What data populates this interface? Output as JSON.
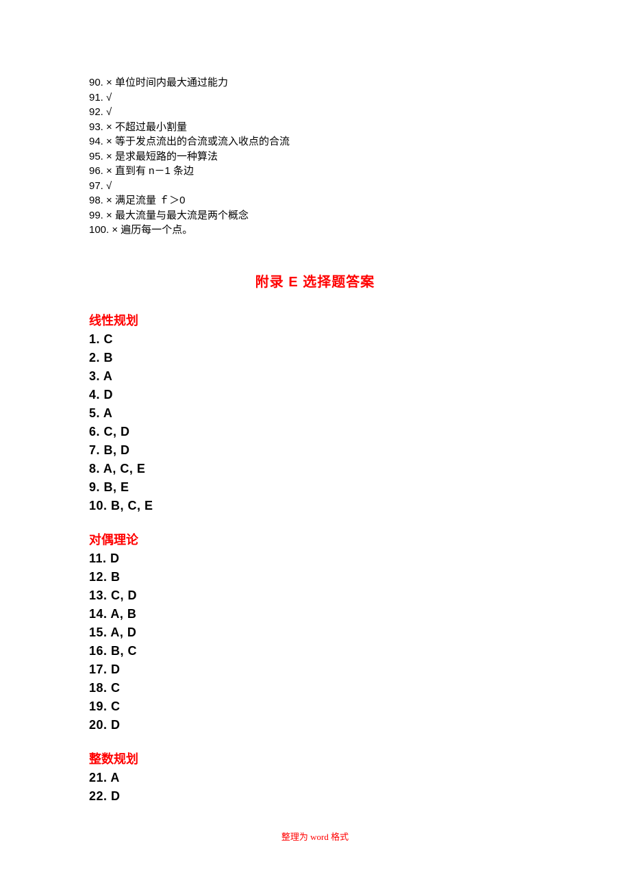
{
  "tf_answers": [
    {
      "num": "90",
      "mark": "×",
      "note": "单位时间内最大通过能力"
    },
    {
      "num": "91",
      "mark": "√",
      "note": ""
    },
    {
      "num": "92",
      "mark": "√",
      "note": ""
    },
    {
      "num": "93",
      "mark": "×",
      "note": "不超过最小割量"
    },
    {
      "num": "94",
      "mark": "×",
      "note": "等于发点流出的合流或流入收点的合流"
    },
    {
      "num": "95",
      "mark": "×",
      "note": "是求最短路的一种算法"
    },
    {
      "num": "96",
      "mark": "×",
      "note": "直到有 n－1 条边"
    },
    {
      "num": "97",
      "mark": "√",
      "note": ""
    },
    {
      "num": "98",
      "mark": "×",
      "note": "满足流量 ｆ＞0"
    },
    {
      "num": "99",
      "mark": "×",
      "note": "最大流量与最大流是两个概念"
    },
    {
      "num": "100",
      "mark": "×",
      "note": "遍历每一个点。"
    }
  ],
  "appendix_title": "附录 E  选择题答案",
  "sections": [
    {
      "heading": "线性规划",
      "answers": [
        {
          "num": "1",
          "ans": "C"
        },
        {
          "num": "2",
          "ans": "B"
        },
        {
          "num": "3",
          "ans": "A"
        },
        {
          "num": "4",
          "ans": "D"
        },
        {
          "num": "5",
          "ans": "A"
        },
        {
          "num": "6",
          "ans": "C, D"
        },
        {
          "num": "7",
          "ans": "B, D"
        },
        {
          "num": "8",
          "ans": "A, C, E"
        },
        {
          "num": "9",
          "ans": "B, E"
        },
        {
          "num": "10",
          "ans": "B, C, E"
        }
      ]
    },
    {
      "heading": "对偶理论",
      "answers": [
        {
          "num": "11",
          "ans": "D"
        },
        {
          "num": "12",
          "ans": "B"
        },
        {
          "num": "13",
          "ans": "C, D"
        },
        {
          "num": "14",
          "ans": "A, B"
        },
        {
          "num": "15",
          "ans": "A, D"
        },
        {
          "num": "16",
          "ans": "B, C"
        },
        {
          "num": "17",
          "ans": "D"
        },
        {
          "num": "18",
          "ans": "C"
        },
        {
          "num": "19",
          "ans": "C"
        },
        {
          "num": "20",
          "ans": "D"
        }
      ]
    },
    {
      "heading": "整数规划",
      "answers": [
        {
          "num": "21",
          "ans": "A"
        },
        {
          "num": "22",
          "ans": "D"
        }
      ]
    }
  ],
  "footer_text": "整理为 word 格式"
}
